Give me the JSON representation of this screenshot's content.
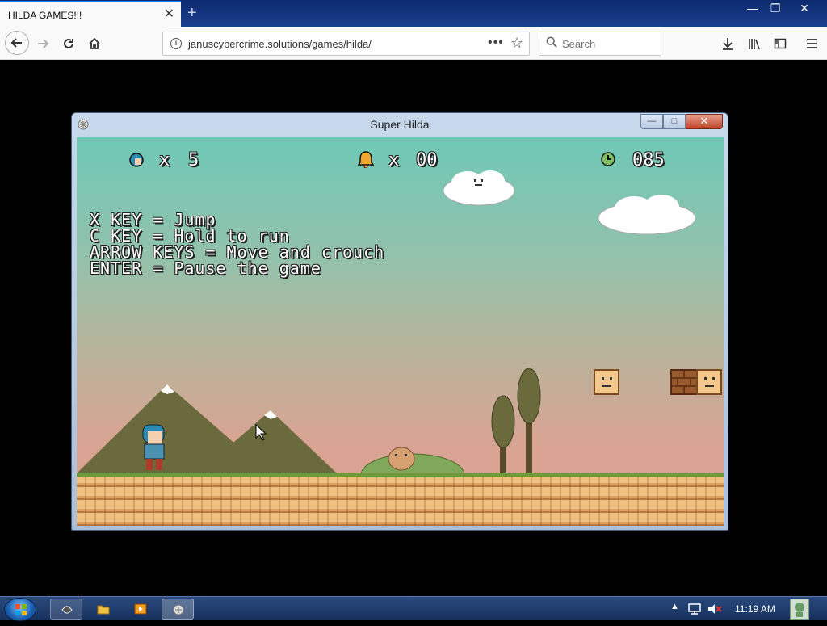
{
  "browser": {
    "tab_title": "HILDA GAMES!!!",
    "tab_close": "✕",
    "new_tab": "+",
    "url": "januscybercrime.solutions/games/hilda/",
    "search_placeholder": "Search",
    "more": "•••",
    "star": "☆"
  },
  "window_controls": {
    "min": "—",
    "max": "❐",
    "close": "✕"
  },
  "game_window": {
    "title": "Super Hilda",
    "min": "—",
    "max": "□",
    "close": "✕"
  },
  "hud": {
    "lives_x": "x",
    "lives": "5",
    "bells_x": "x",
    "bells": "00",
    "time": "085"
  },
  "instructions": {
    "line1": "X KEY = Jump",
    "line2": "C KEY = Hold to run",
    "line3": "ARROW KEYS = Move and crouch",
    "line4": "ENTER = Pause the game"
  },
  "taskbar": {
    "clock": "11:19 AM",
    "tray_arrow": "▲"
  },
  "colors": {
    "sky_top": "#6ec8b6",
    "sky_bottom": "#e0a094",
    "ground": "#f0c080",
    "mountain": "#6b6a3c"
  }
}
